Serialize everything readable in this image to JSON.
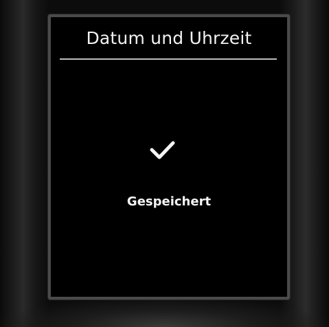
{
  "screen": {
    "title": "Datum und Uhrzeit",
    "status_icon": "checkmark-icon",
    "status_text": "Gespeichert"
  },
  "colors": {
    "screen_background": "#000000",
    "text": "#f2f2f2",
    "divider": "#bdbdbd",
    "device_body": "#0c0c0c",
    "bezel": "#4a4a4a"
  }
}
